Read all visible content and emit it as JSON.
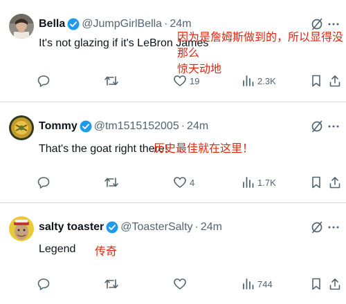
{
  "tweets": [
    {
      "name": "Bella",
      "handle": "@JumpGirlBella",
      "separator": "·",
      "time": "24m",
      "text": "It's not glazing if it's LeBron James",
      "translation_line1": "因为是詹姆斯做到的，所以显得没那么",
      "translation_line2": "惊天动地",
      "reply_count": "",
      "retweet_count": "",
      "like_count": "19",
      "view_count": "2.3K"
    },
    {
      "name": "Tommy",
      "handle": "@tm1515152005",
      "separator": "·",
      "time": "24m",
      "text": "That's the goat right there!",
      "translation_line1": "历史最佳就在这里！",
      "reply_count": "",
      "retweet_count": "",
      "like_count": "4",
      "view_count": "1.7K"
    },
    {
      "name": "salty toaster",
      "handle": "@ToasterSalty",
      "separator": "·",
      "time": "24m",
      "text": "Legend",
      "translation_line1": "传奇",
      "reply_count": "",
      "retweet_count": "",
      "like_count": "",
      "view_count": "744"
    }
  ],
  "colors": {
    "verified": "#1d9bf0",
    "secondary_text": "#536471",
    "translation": "#e8240c",
    "divider": "#cfd9de"
  }
}
